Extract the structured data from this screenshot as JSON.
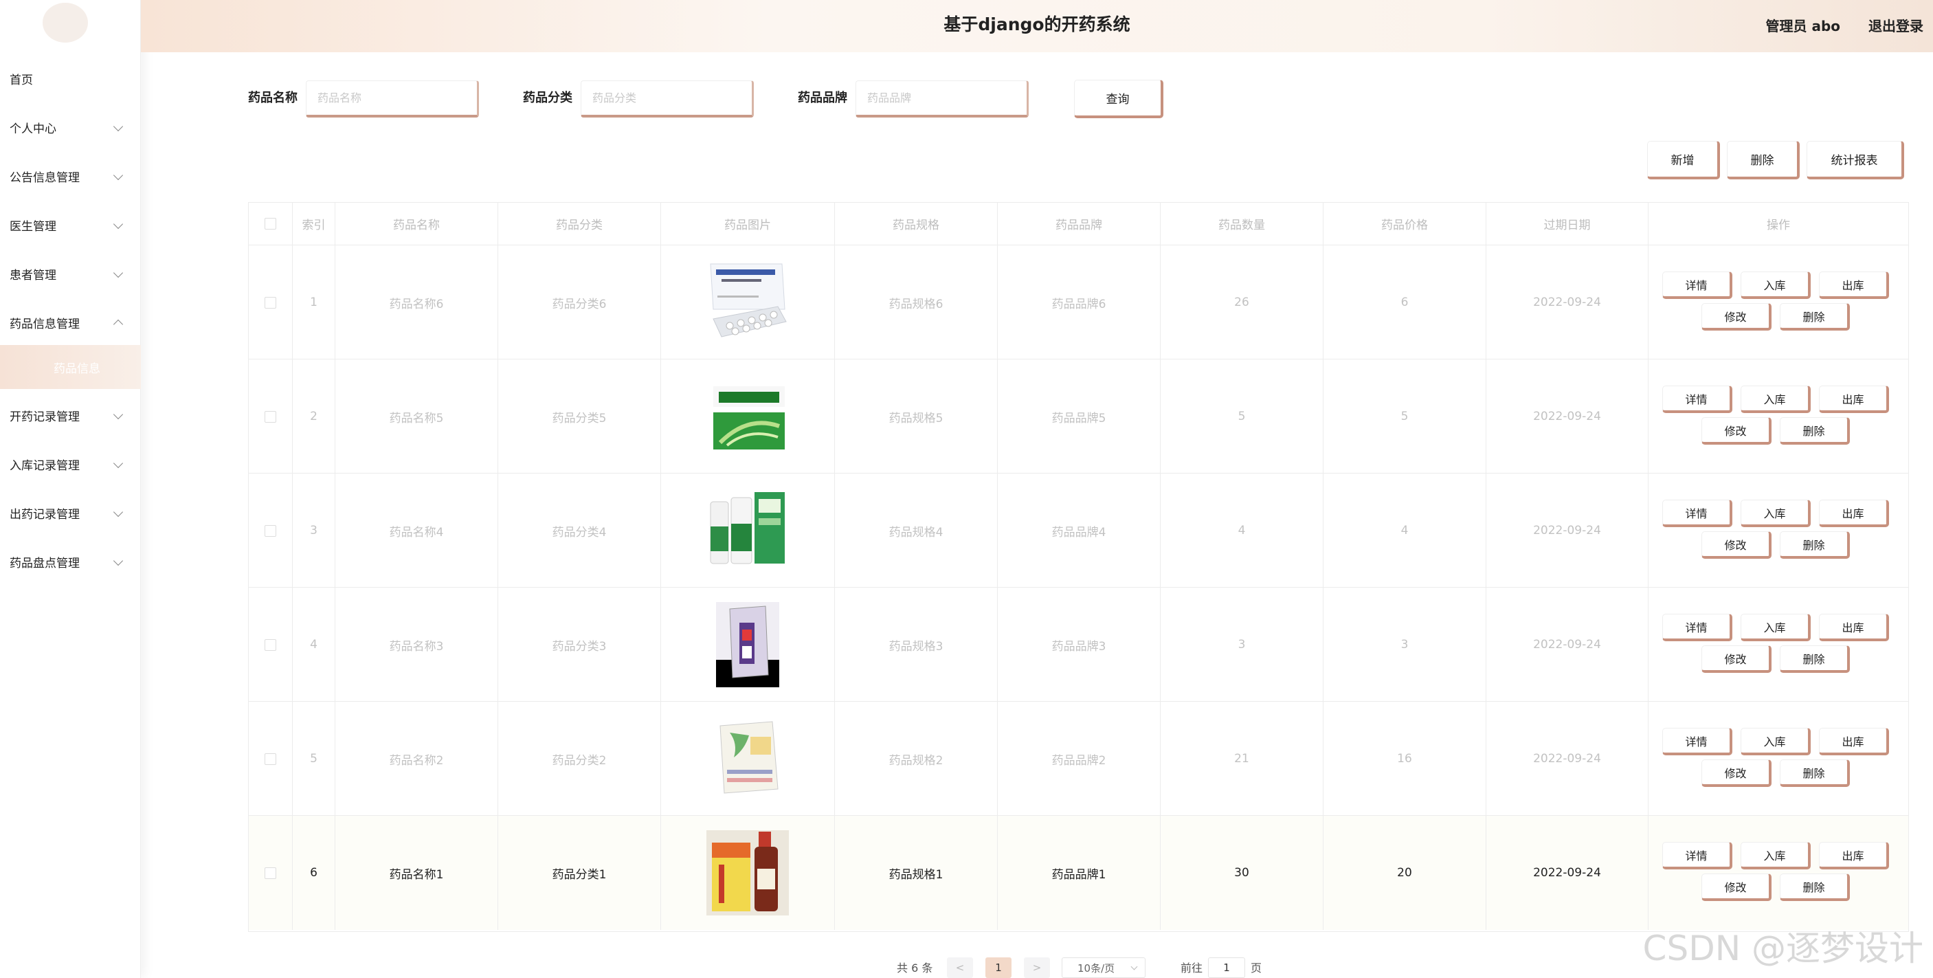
{
  "app": {
    "title": "基于django的开药系统",
    "user_label": "管理员 abo",
    "logout_label": "退出登录"
  },
  "sidebar": {
    "items": [
      {
        "label": "首页",
        "expandable": false
      },
      {
        "label": "个人中心",
        "expandable": true
      },
      {
        "label": "公告信息管理",
        "expandable": true
      },
      {
        "label": "医生管理",
        "expandable": true
      },
      {
        "label": "患者管理",
        "expandable": true
      },
      {
        "label": "药品信息管理",
        "expandable": true,
        "expanded": true
      },
      {
        "label": "开药记录管理",
        "expandable": true
      },
      {
        "label": "入库记录管理",
        "expandable": true
      },
      {
        "label": "出药记录管理",
        "expandable": true
      },
      {
        "label": "药品盘点管理",
        "expandable": true
      }
    ],
    "active_sub": "药品信息"
  },
  "search": {
    "name_label": "药品名称",
    "name_placeholder": "药品名称",
    "category_label": "药品分类",
    "category_placeholder": "药品分类",
    "brand_label": "药品品牌",
    "brand_placeholder": "药品品牌",
    "query_label": "查询"
  },
  "toolbar": {
    "add_label": "新增",
    "delete_label": "删除",
    "report_label": "统计报表"
  },
  "table": {
    "headers": [
      "索引",
      "药品名称",
      "药品分类",
      "药品图片",
      "药品规格",
      "药品品牌",
      "药品数量",
      "药品价格",
      "过期日期",
      "操作"
    ],
    "rows": [
      {
        "index": "1",
        "name": "药品名称6",
        "category": "药品分类6",
        "spec": "药品规格6",
        "brand": "药品品牌6",
        "qty": "26",
        "price": "6",
        "expiry": "2022-09-24"
      },
      {
        "index": "2",
        "name": "药品名称5",
        "category": "药品分类5",
        "spec": "药品规格5",
        "brand": "药品品牌5",
        "qty": "5",
        "price": "5",
        "expiry": "2022-09-24"
      },
      {
        "index": "3",
        "name": "药品名称4",
        "category": "药品分类4",
        "spec": "药品规格4",
        "brand": "药品品牌4",
        "qty": "4",
        "price": "4",
        "expiry": "2022-09-24"
      },
      {
        "index": "4",
        "name": "药品名称3",
        "category": "药品分类3",
        "spec": "药品规格3",
        "brand": "药品品牌3",
        "qty": "3",
        "price": "3",
        "expiry": "2022-09-24"
      },
      {
        "index": "5",
        "name": "药品名称2",
        "category": "药品分类2",
        "spec": "药品规格2",
        "brand": "药品品牌2",
        "qty": "21",
        "price": "16",
        "expiry": "2022-09-24"
      },
      {
        "index": "6",
        "name": "药品名称1",
        "category": "药品分类1",
        "spec": "药品规格1",
        "brand": "药品品牌1",
        "qty": "30",
        "price": "20",
        "expiry": "2022-09-24"
      }
    ],
    "actions": [
      "详情",
      "入库",
      "出库",
      "修改",
      "删除"
    ]
  },
  "pagination": {
    "total": "共 6 条",
    "prev": "<",
    "current": "1",
    "next": ">",
    "page_size": "10条/页",
    "goto_label": "前往",
    "goto_value": "1",
    "page_suffix": "页"
  },
  "watermark": "CSDN @逐梦设计"
}
